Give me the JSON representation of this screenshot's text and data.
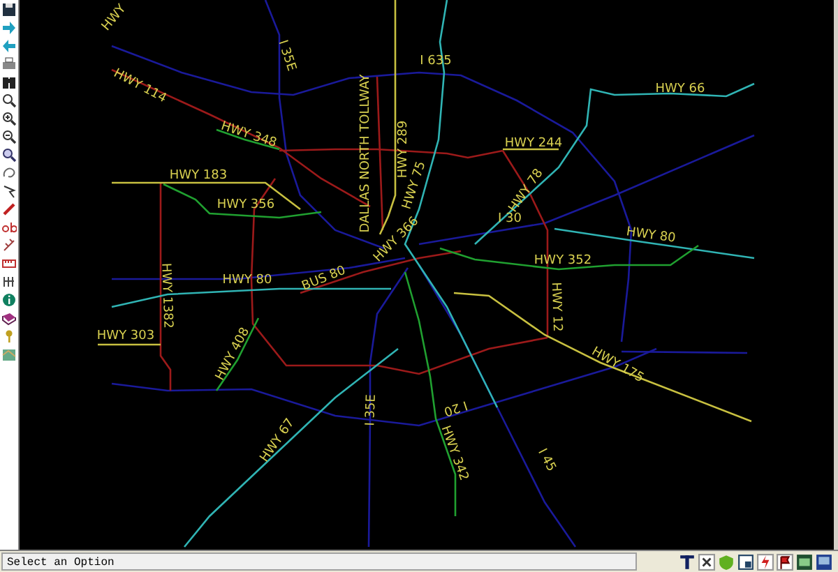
{
  "map": {
    "labels": [
      "HWY",
      "I 35E",
      "I 635",
      "HWY 114",
      "HWY 348",
      "DALLAS NORTH TOLLWAY",
      "HWY 289",
      "HWY 75",
      "HWY 66",
      "HWY 244",
      "HWY 78",
      "HWY 183",
      "HWY 356",
      "I 30",
      "HWY 80",
      "HWY 366",
      "BUS 80",
      "HWY 352",
      "HWY 1382",
      "HWY 80",
      "HWY 12",
      "HWY 303",
      "HWY 408",
      "HWY 175",
      "I 35E",
      "I 20",
      "HWY 67",
      "HWY 342",
      "I 45"
    ]
  },
  "status_bar": {
    "message": "Select an Option"
  }
}
